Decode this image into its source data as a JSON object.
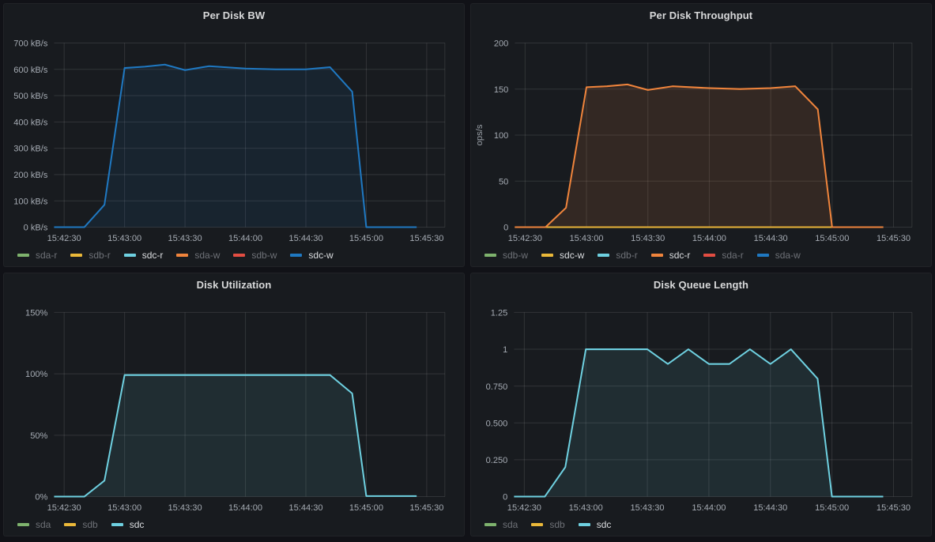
{
  "dashboard": {
    "background": "#111217",
    "panel_background": "#181b1f"
  },
  "text_colors": {
    "title": "#d8d9da",
    "tick": "#a5abb3",
    "axis_label": "#9aa0a7",
    "legend_dim": "#6e7177",
    "legend_active": "#dcdee1",
    "grid": "rgba(255,255,255,0.11)"
  },
  "palette": {
    "green": "#7EB26D",
    "yellow": "#EAB839",
    "cyan": "#6ED0E0",
    "orange": "#EF843C",
    "red": "#E24D42",
    "blue": "#1F78C1"
  },
  "time_axis": {
    "tick_labels": [
      "15:42:30",
      "15:43:00",
      "15:43:30",
      "15:44:00",
      "15:44:30",
      "15:45:00",
      "15:45:30"
    ],
    "tick_seconds": [
      0,
      30,
      60,
      90,
      120,
      150,
      180
    ],
    "domain_seconds": [
      -5,
      189
    ]
  },
  "chart_data": [
    {
      "type": "area",
      "title": "Per Disk BW",
      "ylabel": "",
      "ylim": [
        0,
        700
      ],
      "y_ticks": [
        {
          "label": "700 kB/s",
          "value": 700
        },
        {
          "label": "600 kB/s",
          "value": 600
        },
        {
          "label": "500 kB/s",
          "value": 500
        },
        {
          "label": "400 kB/s",
          "value": 400
        },
        {
          "label": "300 kB/s",
          "value": 300
        },
        {
          "label": "200 kB/s",
          "value": 200
        },
        {
          "label": "100 kB/s",
          "value": 100
        },
        {
          "label": "0 kB/s",
          "value": 0
        }
      ],
      "plot_left": 63,
      "legend": [
        {
          "label": "sda-r",
          "color": "#7EB26D",
          "active": false
        },
        {
          "label": "sdb-r",
          "color": "#EAB839",
          "active": false
        },
        {
          "label": "sdc-r",
          "color": "#6ED0E0",
          "active": true
        },
        {
          "label": "sda-w",
          "color": "#EF843C",
          "active": false
        },
        {
          "label": "sdb-w",
          "color": "#E24D42",
          "active": false
        },
        {
          "label": "sdc-w",
          "color": "#1F78C1",
          "active": true
        }
      ],
      "series": [
        {
          "name": "sdc-w",
          "color": "#1F78C1",
          "fill_opacity": 0.1,
          "points": [
            [
              -5,
              0
            ],
            [
              0,
              0
            ],
            [
              10,
              0
            ],
            [
              20,
              85
            ],
            [
              30,
              605
            ],
            [
              40,
              610
            ],
            [
              50,
              618
            ],
            [
              60,
              597
            ],
            [
              72,
              612
            ],
            [
              90,
              603
            ],
            [
              105,
              600
            ],
            [
              120,
              600
            ],
            [
              132,
              608
            ],
            [
              143,
              515
            ],
            [
              150,
              0
            ],
            [
              160,
              0
            ],
            [
              175,
              0
            ]
          ]
        }
      ]
    },
    {
      "type": "area",
      "title": "Per Disk Throughput",
      "ylabel": "ops/s",
      "ylim": [
        0,
        200
      ],
      "y_ticks": [
        {
          "label": "200",
          "value": 200
        },
        {
          "label": "150",
          "value": 150
        },
        {
          "label": "100",
          "value": 100
        },
        {
          "label": "50",
          "value": 50
        },
        {
          "label": "0",
          "value": 0
        }
      ],
      "plot_left": 55,
      "legend": [
        {
          "label": "sdb-w",
          "color": "#7EB26D",
          "active": false
        },
        {
          "label": "sdc-w",
          "color": "#EAB839",
          "active": true
        },
        {
          "label": "sdb-r",
          "color": "#6ED0E0",
          "active": false
        },
        {
          "label": "sdc-r",
          "color": "#EF843C",
          "active": true
        },
        {
          "label": "sda-r",
          "color": "#E24D42",
          "active": false
        },
        {
          "label": "sda-w",
          "color": "#1F78C1",
          "active": false
        }
      ],
      "series": [
        {
          "name": "sdc-w",
          "color": "#EAB839",
          "fill_opacity": 0,
          "points": [
            [
              -5,
              0
            ],
            [
              175,
              0
            ]
          ]
        },
        {
          "name": "sdc-r",
          "color": "#EF843C",
          "fill_opacity": 0.13,
          "points": [
            [
              -5,
              0
            ],
            [
              0,
              0
            ],
            [
              10,
              0
            ],
            [
              20,
              21
            ],
            [
              30,
              152
            ],
            [
              40,
              153
            ],
            [
              50,
              155
            ],
            [
              60,
              149
            ],
            [
              72,
              153
            ],
            [
              90,
              151
            ],
            [
              105,
              150
            ],
            [
              120,
              151
            ],
            [
              132,
              153
            ],
            [
              143,
              128
            ],
            [
              150,
              0
            ],
            [
              160,
              0
            ],
            [
              175,
              0
            ]
          ]
        }
      ]
    },
    {
      "type": "area",
      "title": "Disk Utilization",
      "ylabel": "",
      "ylim": [
        0,
        150
      ],
      "y_ticks": [
        {
          "label": "150%",
          "value": 150
        },
        {
          "label": "100%",
          "value": 100
        },
        {
          "label": "50%",
          "value": 50
        },
        {
          "label": "0%",
          "value": 0
        }
      ],
      "plot_left": 63,
      "legend": [
        {
          "label": "sda",
          "color": "#7EB26D",
          "active": false
        },
        {
          "label": "sdb",
          "color": "#EAB839",
          "active": false
        },
        {
          "label": "sdc",
          "color": "#6ED0E0",
          "active": true
        }
      ],
      "series": [
        {
          "name": "sdc",
          "color": "#6ED0E0",
          "fill_opacity": 0.1,
          "points": [
            [
              -5,
              0
            ],
            [
              0,
              0
            ],
            [
              10,
              0
            ],
            [
              20,
              13
            ],
            [
              30,
              99
            ],
            [
              60,
              99
            ],
            [
              90,
              99
            ],
            [
              120,
              99
            ],
            [
              132,
              99
            ],
            [
              143,
              84
            ],
            [
              150,
              0.4
            ],
            [
              160,
              0.4
            ],
            [
              175,
              0.4
            ]
          ]
        }
      ]
    },
    {
      "type": "area",
      "title": "Disk Queue Length",
      "ylabel": "",
      "ylim": [
        0,
        1.25
      ],
      "y_ticks": [
        {
          "label": "1.25",
          "value": 1.25
        },
        {
          "label": "1",
          "value": 1
        },
        {
          "label": "0.750",
          "value": 0.75
        },
        {
          "label": "0.500",
          "value": 0.5
        },
        {
          "label": "0.250",
          "value": 0.25
        },
        {
          "label": "0",
          "value": 0
        }
      ],
      "plot_left": 54,
      "legend": [
        {
          "label": "sda",
          "color": "#7EB26D",
          "active": false
        },
        {
          "label": "sdb",
          "color": "#EAB839",
          "active": false
        },
        {
          "label": "sdc",
          "color": "#6ED0E0",
          "active": true
        }
      ],
      "series": [
        {
          "name": "sdc",
          "color": "#6ED0E0",
          "fill_opacity": 0.1,
          "points": [
            [
              -5,
              0
            ],
            [
              0,
              0
            ],
            [
              10,
              0
            ],
            [
              20,
              0.2
            ],
            [
              30,
              1
            ],
            [
              40,
              1
            ],
            [
              50,
              1
            ],
            [
              60,
              1
            ],
            [
              70,
              0.9
            ],
            [
              80,
              1
            ],
            [
              90,
              0.9
            ],
            [
              100,
              0.9
            ],
            [
              110,
              1
            ],
            [
              120,
              0.9
            ],
            [
              130,
              1
            ],
            [
              143,
              0.8
            ],
            [
              150,
              0
            ],
            [
              160,
              0
            ],
            [
              175,
              0
            ]
          ]
        }
      ]
    }
  ]
}
